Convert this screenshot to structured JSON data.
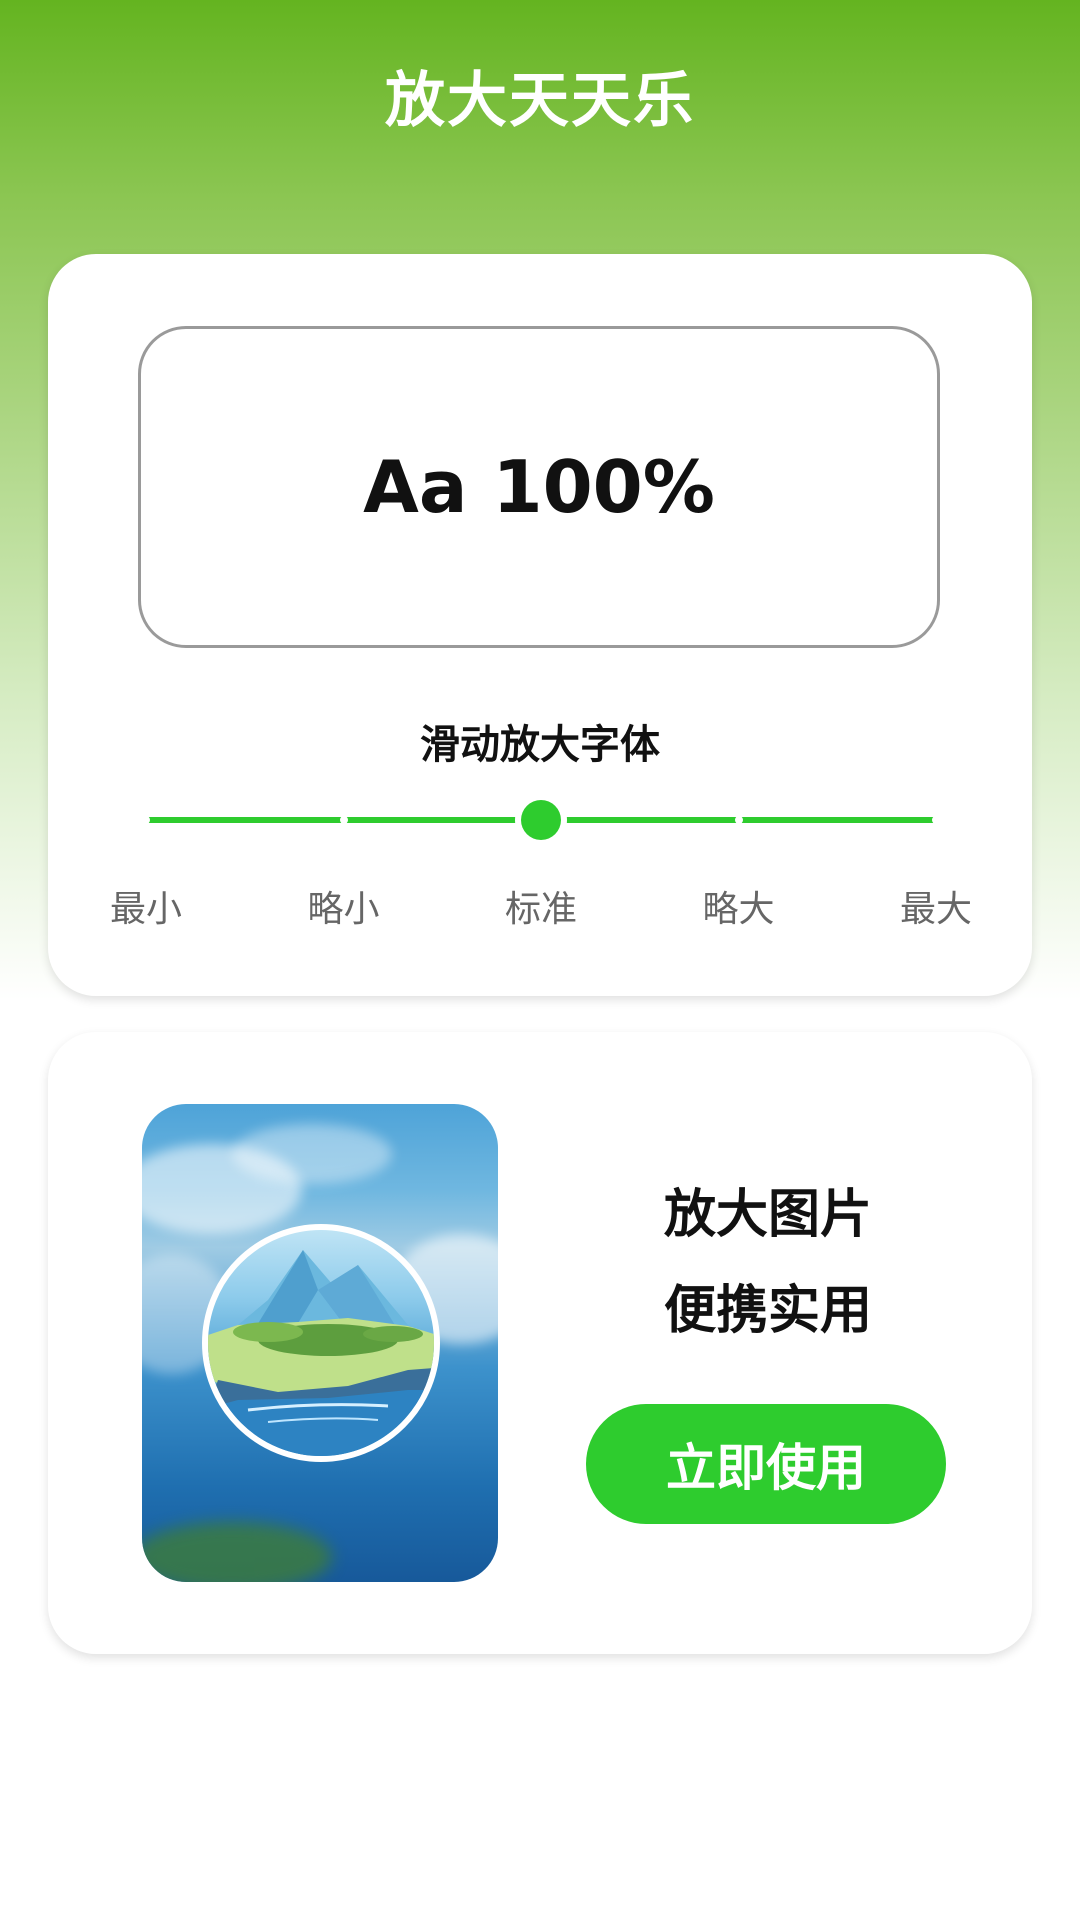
{
  "app": {
    "title": "放大天天乐"
  },
  "font_card": {
    "preview_text": "Aa 100%",
    "slider_title": "滑动放大字体",
    "slider": {
      "levels": [
        "最小",
        "略小",
        "标准",
        "略大",
        "最大"
      ],
      "selected_index": 2
    }
  },
  "image_card": {
    "promo_line1": "放大图片",
    "promo_line2": "便携实用",
    "button_label": "立即使用",
    "image_icon": "magnified-landscape-illustration"
  },
  "colors": {
    "accent": "#2ecc2e",
    "header_gradient_top": "#64b420",
    "title_text": "#ffffff"
  }
}
